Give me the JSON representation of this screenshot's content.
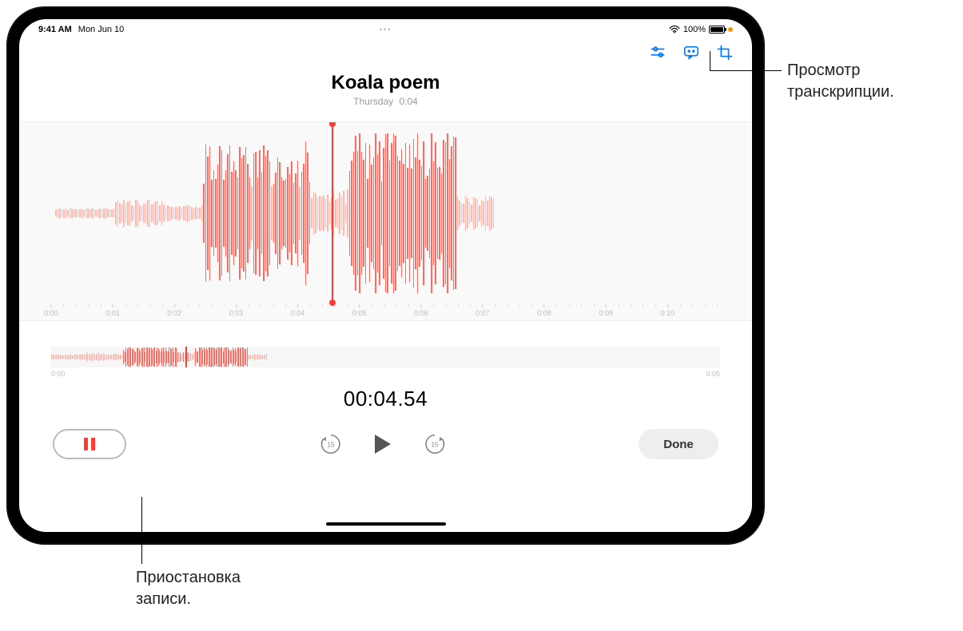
{
  "status": {
    "time": "9:41 AM",
    "date": "Mon Jun 10",
    "battery_pct": "100%"
  },
  "recording": {
    "title": "Koala poem",
    "day": "Thursday",
    "duration": "0:04"
  },
  "timeline": {
    "ticks": [
      "0:00",
      "0:01",
      "0:02",
      "0:03",
      "0:04",
      "0:05",
      "0:06",
      "0:07",
      "0:08",
      "0:09",
      "0:10"
    ],
    "overview_start": "0:00",
    "overview_end": "0:05"
  },
  "timer": "00:04.54",
  "buttons": {
    "skip_back_seconds": "15",
    "skip_fwd_seconds": "15",
    "done": "Done"
  },
  "callouts": {
    "transcript": "Просмотр\nтранскрипции.",
    "pause": "Приостановка\nзаписи."
  }
}
